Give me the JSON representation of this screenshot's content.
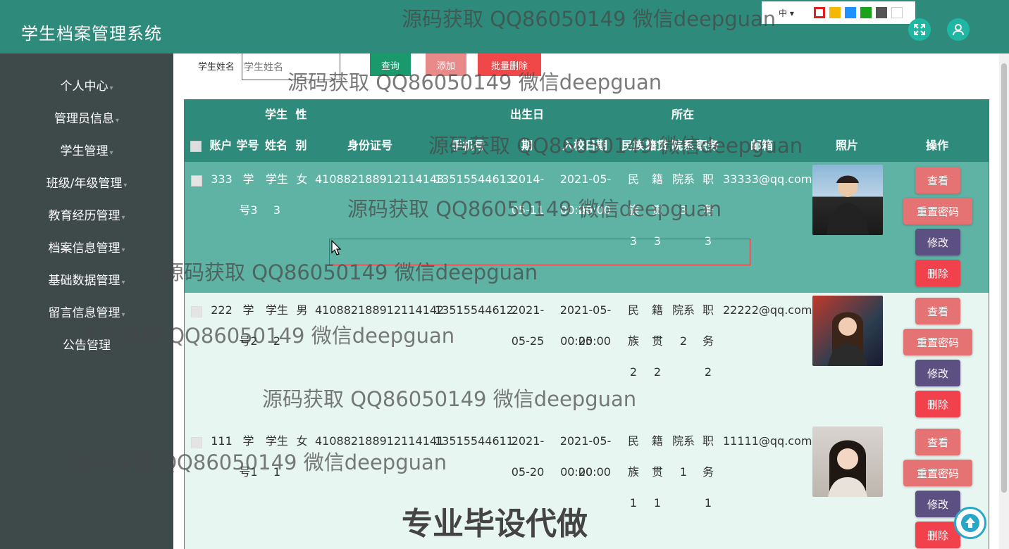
{
  "header": {
    "title": "学生档案管理系统",
    "lang": "中 ▾",
    "theme_colors": [
      "#e01e1e",
      "#f5b800",
      "#1e90ff",
      "#1aa31a",
      "#555555",
      "#ffffff"
    ],
    "fullscreen_icon": "expand-icon",
    "user_icon": "user-icon"
  },
  "sidebar": {
    "items": [
      {
        "label": "个人中心"
      },
      {
        "label": "管理员信息"
      },
      {
        "label": "学生管理"
      },
      {
        "label": "班级/年级管理"
      },
      {
        "label": "教育经历管理"
      },
      {
        "label": "档案信息管理"
      },
      {
        "label": "基础数据管理"
      },
      {
        "label": "留言信息管理"
      },
      {
        "label": "公告管理"
      }
    ]
  },
  "search": {
    "label": "学生姓名",
    "placeholder": "学生姓名",
    "query_btn": "查询",
    "add_btn": "添加",
    "batch_delete_btn": "批量删除"
  },
  "table": {
    "headers": {
      "account": "账户",
      "student_no": "学号",
      "name_1": "学生",
      "name_2": "姓名",
      "gender_1": "性",
      "gender_2": "别",
      "id_card": "身份证号",
      "phone": "手机号",
      "birthday_1": "出生日",
      "birthday_2": "期",
      "enroll_date": "入校日期",
      "ethnic": "民族",
      "origin": "籍贯",
      "dept_1": "所在",
      "dept_2": "院系",
      "position": "职务",
      "email": "邮箱",
      "photo": "照片",
      "ops": "操作"
    },
    "rows": [
      {
        "account": "333",
        "student_no": [
          "学",
          "号3"
        ],
        "name": [
          "学生",
          "3"
        ],
        "gender": "女",
        "id_card": "410882188912114143",
        "phone": "13515544613",
        "birthday": [
          "2014-",
          "05-11"
        ],
        "enroll": [
          "2021-05-28",
          "00:00:00"
        ],
        "ethnic": [
          "民",
          "族",
          "3"
        ],
        "origin": [
          "籍",
          "贯",
          "3"
        ],
        "dept": [
          "院系",
          "3"
        ],
        "position": [
          "职",
          "务",
          "3"
        ],
        "email": "33333@qq.com"
      },
      {
        "account": "222",
        "student_no": [
          "学",
          "号2"
        ],
        "name": [
          "学生",
          "2"
        ],
        "gender": "男",
        "id_card": "410882188912114142",
        "phone": "13515544612",
        "birthday": [
          "2021-",
          "05-25"
        ],
        "enroll": [
          "2021-05-25",
          "00:00:00"
        ],
        "ethnic": [
          "民",
          "族",
          "2"
        ],
        "origin": [
          "籍",
          "贯",
          "2"
        ],
        "dept": [
          "院系",
          "2"
        ],
        "position": [
          "职",
          "务",
          "2"
        ],
        "email": "22222@qq.com"
      },
      {
        "account": "111",
        "student_no": [
          "学",
          "号1"
        ],
        "name": [
          "学生",
          "1"
        ],
        "gender": "女",
        "id_card": "410882188912114141",
        "phone": "13515544611",
        "birthday": [
          "2021-",
          "05-20"
        ],
        "enroll": [
          "2021-05-20",
          "00:00:00"
        ],
        "ethnic": [
          "民",
          "族",
          "1"
        ],
        "origin": [
          "籍",
          "贯",
          "1"
        ],
        "dept": [
          "院系",
          "1"
        ],
        "position": [
          "职",
          "务",
          "1"
        ],
        "email": "11111@qq.com"
      }
    ],
    "actions": {
      "view": "查看",
      "reset": "重置密码",
      "edit": "修改",
      "delete": "删除"
    }
  },
  "colors": {
    "theme": "#2e8b7b",
    "sidebar": "#3e4a4a",
    "row_selected": "#5fb3a5",
    "row_normal": "#e8f6f2"
  },
  "watermark": "源码获取 QQ86050149 微信deepguan",
  "watermark_big": "专业毕设代做"
}
